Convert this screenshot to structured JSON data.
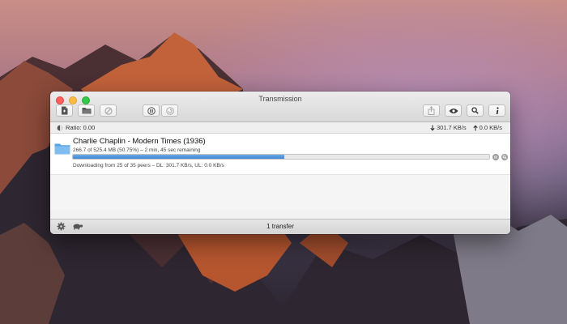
{
  "window": {
    "title": "Transmission"
  },
  "toolbar": {
    "left_icons": [
      "new-document-icon",
      "open-folder-icon",
      "remove-icon"
    ],
    "middle_icons": [
      "pause-all-icon",
      "resume-all-icon"
    ],
    "right_icons": [
      "share-icon",
      "quick-look-icon",
      "search-icon",
      "info-icon"
    ]
  },
  "status": {
    "ratio": "Ratio: 0.00",
    "download_speed": "301.7 KB/s",
    "upload_speed": "0.0 KB/s"
  },
  "transfers": [
    {
      "name": "Charlie Chaplin - Modern Times (1936)",
      "progress_text": "266.7 of 525.4 MB (50.75%) – 2 min, 45 sec remaining",
      "progress": 0.5075,
      "peers_text": "Downloading from 25 of 35 peers – DL: 301.7 KB/s, UL: 0.0 KB/s"
    }
  ],
  "footer": {
    "count": "1 transfer"
  },
  "colors": {
    "progress": "#4a8fdc",
    "close": "#fc605c",
    "minimize": "#fdbc40",
    "zoom": "#34c84a"
  }
}
